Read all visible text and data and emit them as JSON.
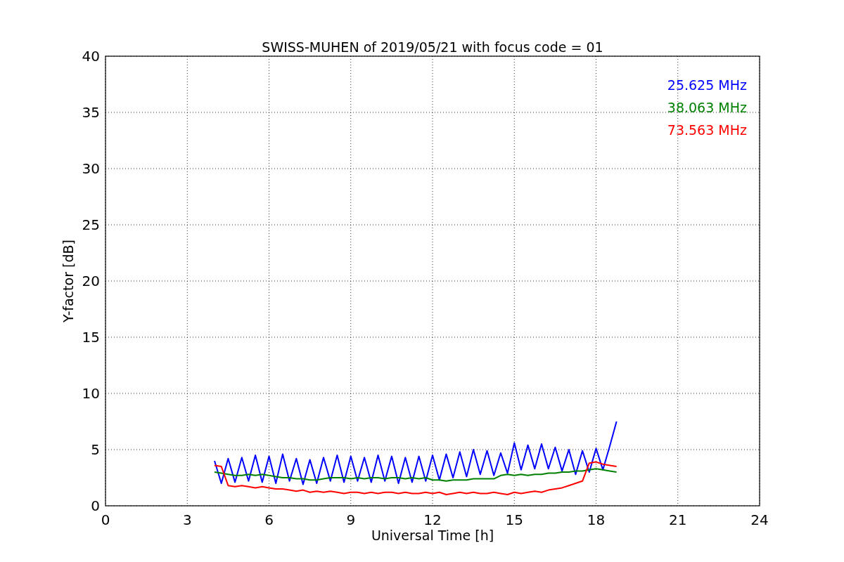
{
  "chart_data": {
    "type": "line",
    "title": "SWISS-MUHEN of 2019/05/21 with focus code = 01",
    "xlabel": "Universal Time [h]",
    "ylabel": "Y-factor [dB]",
    "x": [
      4,
      4.25,
      4.5,
      4.75,
      5,
      5.25,
      5.5,
      5.75,
      6,
      6.25,
      6.5,
      6.75,
      7,
      7.25,
      7.5,
      7.75,
      8,
      8.25,
      8.5,
      8.75,
      9,
      9.25,
      9.5,
      9.75,
      10,
      10.25,
      10.5,
      10.75,
      11,
      11.25,
      11.5,
      11.75,
      12,
      12.25,
      12.5,
      12.75,
      13,
      13.25,
      13.5,
      13.75,
      14,
      14.25,
      14.5,
      14.75,
      15,
      15.25,
      15.5,
      15.75,
      16,
      16.25,
      16.5,
      16.75,
      17,
      17.25,
      17.5,
      17.75,
      18,
      18.25,
      18.5,
      18.75
    ],
    "series": [
      {
        "name": "25.625 MHz",
        "color": "#0000ff",
        "values": [
          4.0,
          2.0,
          4.2,
          2.1,
          4.3,
          2.2,
          4.5,
          2.1,
          4.4,
          2.0,
          4.6,
          2.2,
          4.2,
          1.9,
          4.1,
          2.0,
          4.3,
          2.2,
          4.5,
          2.1,
          4.4,
          2.2,
          4.3,
          2.1,
          4.5,
          2.2,
          4.4,
          2.0,
          4.3,
          2.1,
          4.4,
          2.2,
          4.5,
          2.3,
          4.6,
          2.5,
          4.8,
          2.6,
          5.0,
          2.8,
          4.9,
          2.7,
          4.7,
          2.9,
          5.6,
          3.2,
          5.4,
          3.3,
          5.5,
          3.3,
          5.2,
          3.1,
          5.0,
          2.8,
          4.9,
          3.0,
          5.1,
          3.2,
          5.3,
          7.5
        ]
      },
      {
        "name": "38.063 MHz",
        "color": "#008000",
        "values": [
          3.0,
          2.9,
          2.8,
          2.7,
          2.7,
          2.8,
          2.7,
          2.8,
          2.7,
          2.6,
          2.5,
          2.5,
          2.4,
          2.4,
          2.3,
          2.3,
          2.4,
          2.5,
          2.5,
          2.5,
          2.4,
          2.5,
          2.4,
          2.5,
          2.5,
          2.4,
          2.5,
          2.5,
          2.4,
          2.5,
          2.4,
          2.5,
          2.3,
          2.3,
          2.2,
          2.3,
          2.3,
          2.3,
          2.4,
          2.4,
          2.4,
          2.4,
          2.7,
          2.8,
          2.7,
          2.8,
          2.7,
          2.8,
          2.8,
          2.9,
          2.9,
          3.0,
          3.0,
          3.1,
          3.1,
          3.2,
          3.3,
          3.2,
          3.1,
          3.0
        ]
      },
      {
        "name": "73.563 MHz",
        "color": "#ff0000",
        "values": [
          3.6,
          3.5,
          1.8,
          1.7,
          1.8,
          1.7,
          1.6,
          1.7,
          1.6,
          1.5,
          1.5,
          1.4,
          1.3,
          1.4,
          1.2,
          1.3,
          1.2,
          1.3,
          1.2,
          1.1,
          1.2,
          1.2,
          1.1,
          1.2,
          1.1,
          1.2,
          1.2,
          1.1,
          1.2,
          1.1,
          1.1,
          1.2,
          1.1,
          1.2,
          1.0,
          1.1,
          1.2,
          1.1,
          1.2,
          1.1,
          1.1,
          1.2,
          1.1,
          1.0,
          1.2,
          1.1,
          1.2,
          1.3,
          1.2,
          1.4,
          1.5,
          1.6,
          1.8,
          2.0,
          2.2,
          3.8,
          3.9,
          3.7,
          3.6,
          3.5
        ]
      }
    ],
    "xlim": [
      0,
      24
    ],
    "ylim": [
      0,
      40
    ],
    "xticks": [
      0,
      3,
      6,
      9,
      12,
      15,
      18,
      21,
      24
    ],
    "yticks": [
      0,
      5,
      10,
      15,
      20,
      25,
      30,
      35,
      40
    ],
    "grid": true
  }
}
